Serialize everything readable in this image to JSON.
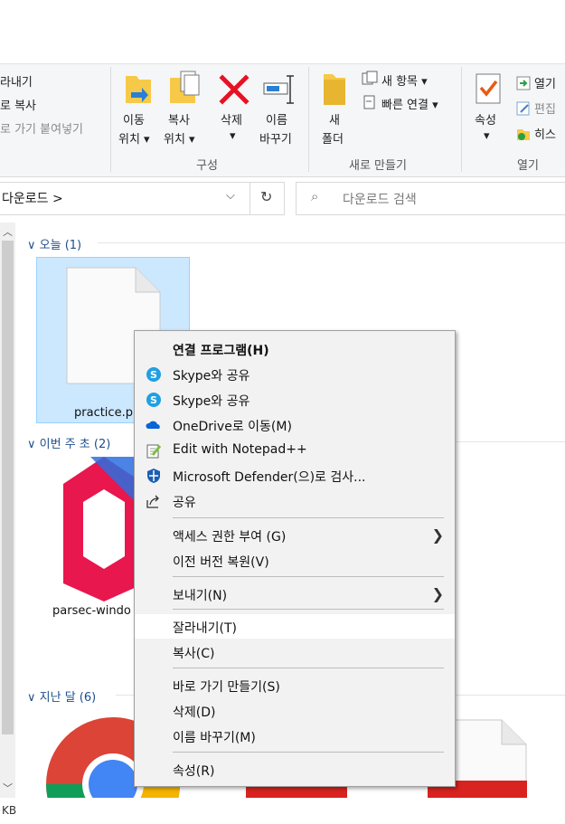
{
  "ribbon": {
    "clipboard_partial": [
      "라내기",
      "로 복사",
      "로 가기 붙여넣기"
    ],
    "move_to": [
      "이동",
      "위치 ▾"
    ],
    "copy_to": [
      "복사",
      "위치 ▾"
    ],
    "delete": [
      "삭제",
      "▾"
    ],
    "rename": [
      "이름",
      "바꾸기"
    ],
    "new_folder": [
      "새",
      "폴더"
    ],
    "new_item": "새 항목 ▾",
    "easy_access": "빠른 연결 ▾",
    "properties": [
      "속성",
      "▾"
    ],
    "open": "열기",
    "edit": "편집",
    "history": "히스",
    "group_organize": "구성",
    "group_new": "새로 만들기",
    "group_open": "열기"
  },
  "address": {
    "path": "다운로드 >",
    "search_placeholder": "다운로드 검색"
  },
  "groups": {
    "today": "오늘 (1)",
    "this_week": "이번 주 초 (2)",
    "last_month": "지난 달 (6)"
  },
  "files": {
    "practice": "practice.p",
    "parsec": "parsec-windo"
  },
  "status": {
    "size_partial": "KB"
  },
  "context_menu": {
    "open_with": "연결 프로그램(H)",
    "skype_share_1": "Skype와 공유",
    "skype_share_2": "Skype와 공유",
    "onedrive": "OneDrive로 이동(M)",
    "notepad": "Edit with Notepad++",
    "defender": "Microsoft Defender(으)로 검사...",
    "share": "공유",
    "give_access": "액세스 권한 부여 (G)",
    "restore": "이전 버전 복원(V)",
    "send_to": "보내기(N)",
    "cut": "잘라내기(T)",
    "copy": "복사(C)",
    "shortcut": "바로 가기 만들기(S)",
    "delete": "삭제(D)",
    "rename": "이름 바꾸기(M)",
    "properties": "속성(R)"
  },
  "colors": {
    "selection": "#cce8ff",
    "menu_bg": "#f2f2f2",
    "group_header": "#1e4e8c",
    "delete_red": "#e81123"
  }
}
